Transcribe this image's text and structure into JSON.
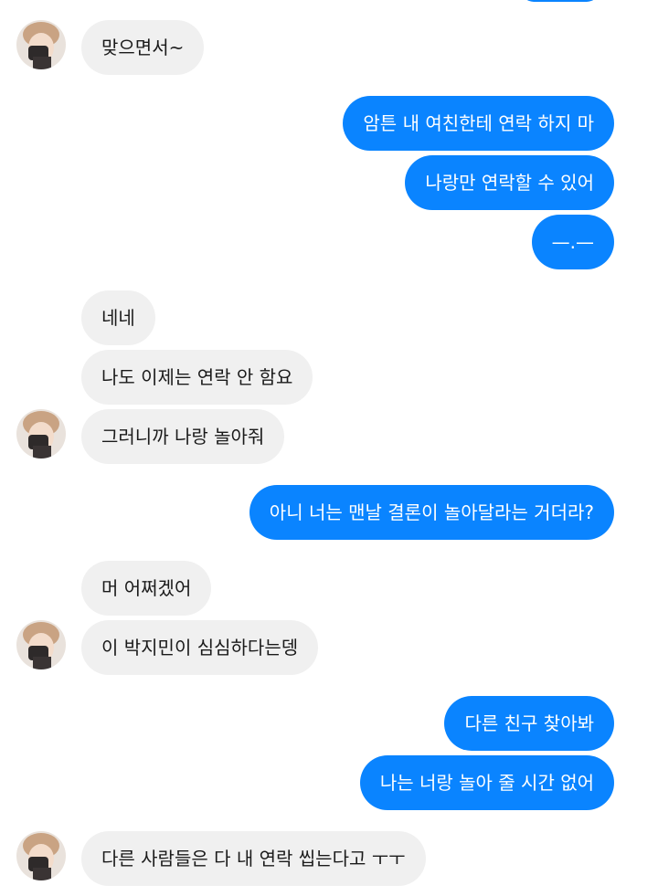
{
  "messages": [
    {
      "text": "맞으면서~"
    },
    {
      "text": "암튼 내 여친한테 연락 하지 마"
    },
    {
      "text": "나랑만 연락할 수 있어"
    },
    {
      "text": "—.—"
    },
    {
      "text": "네네"
    },
    {
      "text": "나도 이제는 연락 안 함요"
    },
    {
      "text": "그러니까 나랑 놀아줘"
    },
    {
      "text": "아니 너는 맨날 결론이 놀아달라는 거더라?"
    },
    {
      "text": "머 어쩌겠어"
    },
    {
      "text": "이 박지민이 심심하다는뎅"
    },
    {
      "text": "다른 친구 찾아봐"
    },
    {
      "text": "나는 너랑 놀아 줄 시간 없어"
    },
    {
      "text": "다른 사람들은 다 내 연락 씹는다고 ㅜㅜ"
    }
  ],
  "colors": {
    "outgoing_bubble": "#0a84ff",
    "incoming_bubble": "#f0f0f0"
  },
  "icons": {
    "avatar": "profile-photo-icon"
  }
}
